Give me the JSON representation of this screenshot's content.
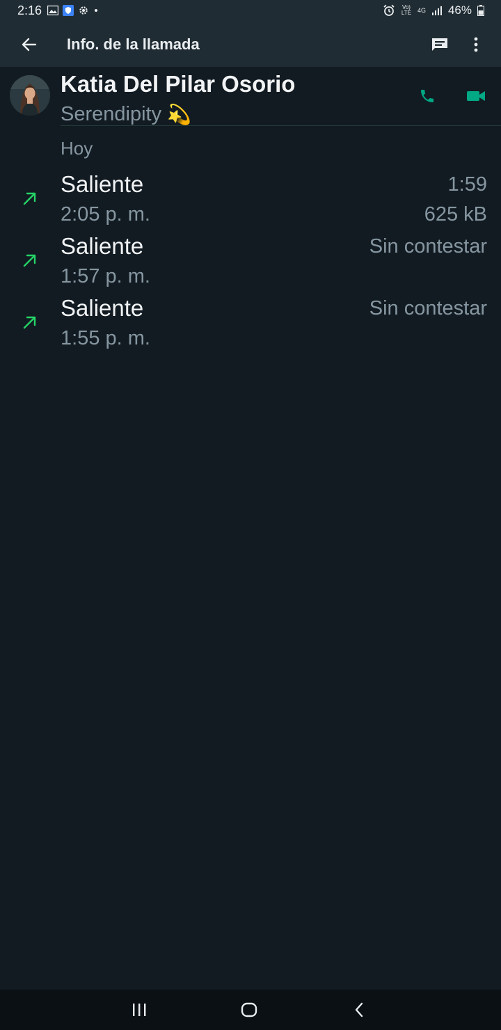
{
  "status_bar": {
    "time": "2:16",
    "battery": "46%",
    "network": "4G",
    "volte": "Vo) LTE"
  },
  "app_bar": {
    "title": "Info. de la llamada"
  },
  "contact": {
    "name": "Katia Del Pilar Osorio",
    "status": "Serendipity",
    "status_emoji": "💫"
  },
  "section": {
    "date_label": "Hoy"
  },
  "calls": [
    {
      "type": "Saliente",
      "time": "2:05 p. m.",
      "meta1": "1:59",
      "meta2": "625 kB"
    },
    {
      "type": "Saliente",
      "time": "1:57 p. m.",
      "meta1": "Sin contestar",
      "meta2": ""
    },
    {
      "type": "Saliente",
      "time": "1:55 p. m.",
      "meta1": "Sin contestar",
      "meta2": ""
    }
  ],
  "colors": {
    "background": "#121b22",
    "app_bar": "#202c33",
    "accent_green": "#00a884",
    "arrow_green": "#25d366",
    "secondary_text": "#8696a0"
  },
  "icons": {
    "back": "arrow-left-icon",
    "message": "message-icon",
    "more": "more-vert-icon",
    "call": "phone-icon",
    "video": "videocam-icon",
    "outgoing": "outgoing-arrow-icon"
  }
}
